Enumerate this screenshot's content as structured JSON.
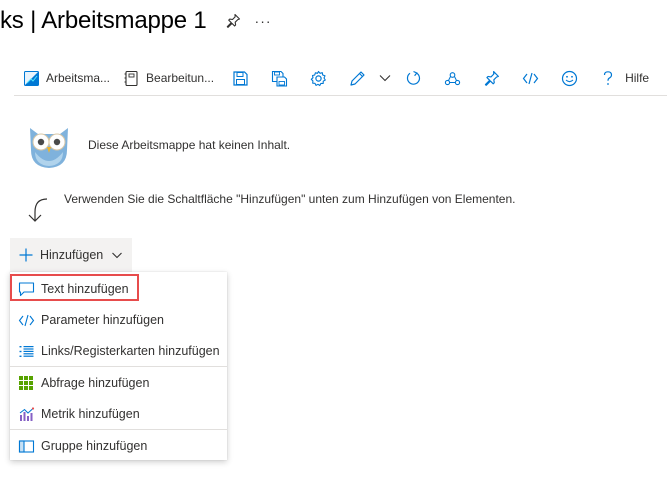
{
  "page": {
    "title": "ks | Arbeitsmappe 1",
    "more": "···"
  },
  "toolbar": {
    "items": [
      {
        "label": "Arbeitsma..."
      },
      {
        "label": "Bearbeitun..."
      },
      {
        "label": ""
      },
      {
        "label": ""
      },
      {
        "label": ""
      },
      {
        "label": ""
      },
      {
        "label": ""
      },
      {
        "label": ""
      },
      {
        "label": ""
      },
      {
        "label": ""
      },
      {
        "label": ""
      },
      {
        "label": "Hilfe"
      }
    ]
  },
  "empty_state": {
    "message": "Diese Arbeitsmappe hat keinen Inhalt.",
    "hint": "Verwenden Sie die Schaltfläche \"Hinzufügen\" unten zum Hinzufügen von Elementen."
  },
  "add_button": {
    "label": "Hinzufügen"
  },
  "menu": {
    "items": [
      {
        "label": "Text hinzufügen",
        "icon": "comment-icon"
      },
      {
        "label": "Parameter hinzufügen",
        "icon": "code-icon"
      },
      {
        "label": "Links/Registerkarten hinzufügen",
        "icon": "list-icon"
      },
      {
        "label": "Abfrage hinzufügen",
        "icon": "grid-icon"
      },
      {
        "label": "Metrik hinzufügen",
        "icon": "metric-chart-icon"
      },
      {
        "label": "Gruppe hinzufügen",
        "icon": "group-icon"
      }
    ]
  },
  "colors": {
    "accent": "#0078d4",
    "highlight": "#e74c4c",
    "query_green": "#57a300",
    "metric_purple": "#8661c5"
  }
}
